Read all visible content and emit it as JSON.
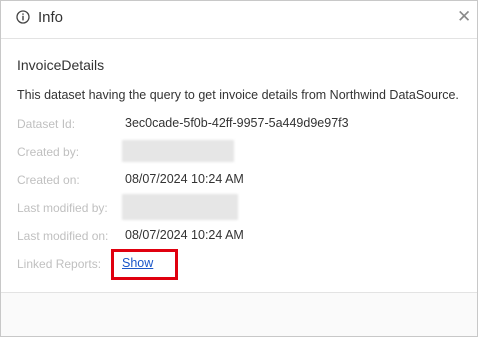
{
  "dialog": {
    "title": "Info",
    "dataset_name": "InvoiceDetails",
    "description": "This dataset having the query to get invoice details from Northwind DataSource."
  },
  "details": {
    "dataset_id_label": "Dataset Id:",
    "dataset_id_value": "3ec0cade-5f0b-42ff-9957-5a449d9e97f3",
    "created_by_label": "Created by:",
    "created_on_label": "Created on:",
    "created_on_value": "08/07/2024 10:24 AM",
    "last_modified_by_label": "Last modified by:",
    "last_modified_on_label": "Last modified on:",
    "last_modified_on_value": "08/07/2024 10:24 AM",
    "linked_reports_label": "Linked Reports:",
    "show_link": "Show"
  },
  "icons": {
    "header": "info-circle-icon",
    "close": "close-icon"
  },
  "colors": {
    "link": "#1a56c9",
    "highlight": "#e0000f"
  }
}
